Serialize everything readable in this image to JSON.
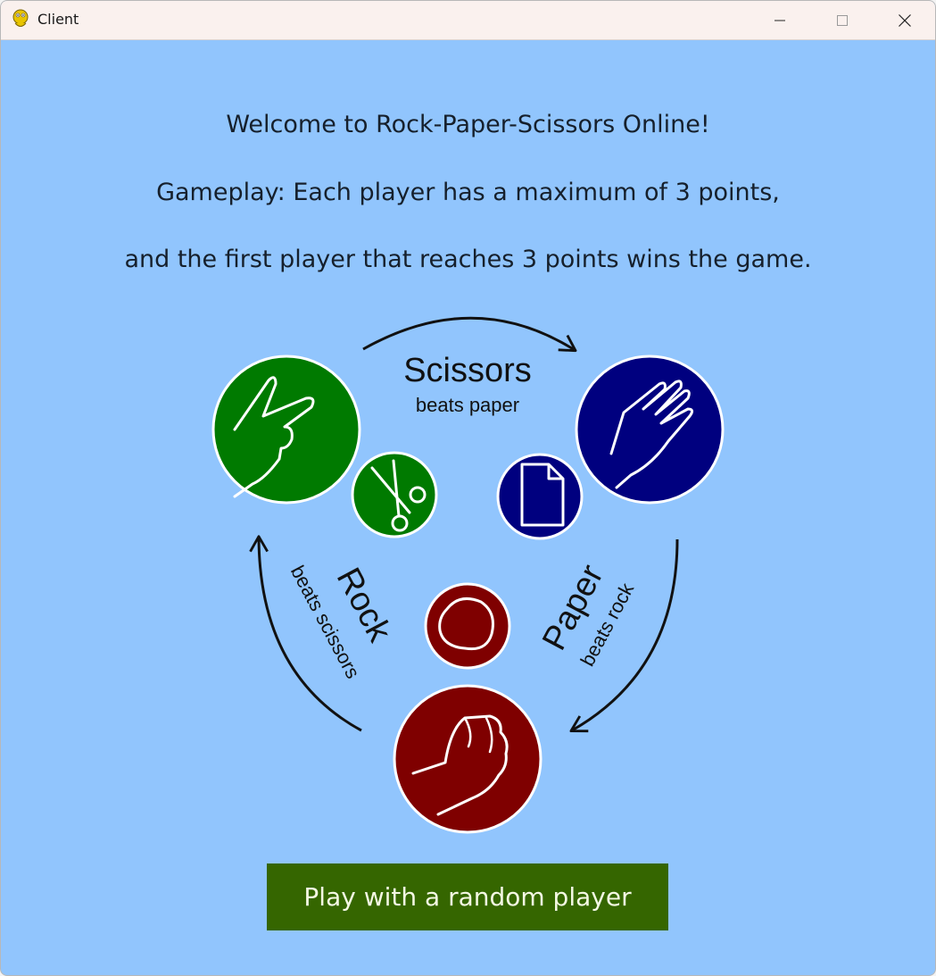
{
  "window": {
    "title": "Client",
    "app_icon": "python-icon",
    "controls": [
      "minimize-icon",
      "maximize-icon",
      "close-icon"
    ]
  },
  "intro": {
    "line1": "Welcome to Rock-Paper-Scissors Online!",
    "line2": "Gameplay: Each player has a maximum of 3 points,",
    "line3": "and the first player that reaches 3 points wins the game."
  },
  "diagram": {
    "scissors": {
      "name": "Scissors",
      "beats": "beats paper",
      "color": "#007a00"
    },
    "paper": {
      "name": "Paper",
      "beats": "beats rock",
      "color": "#00007f"
    },
    "rock": {
      "name": "Rock",
      "beats": "beats scissors",
      "color": "#7f0000"
    }
  },
  "actions": {
    "play_random": "Play with a random player"
  },
  "colors": {
    "background": "#91c5fd",
    "button": "#356600",
    "button_text": "#f4f8e3"
  }
}
